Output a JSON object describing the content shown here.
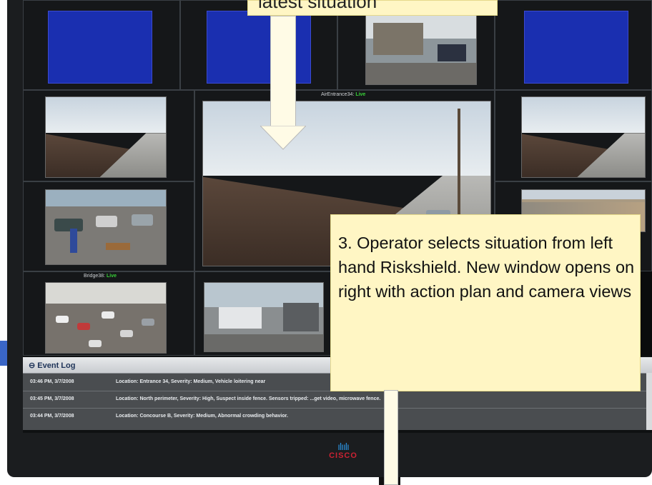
{
  "cameras": {
    "air_entrance": {
      "name": "AirEntrance34:",
      "status": "Live"
    },
    "bridge": {
      "name": "Bridge38:",
      "status": "Live"
    }
  },
  "event_log": {
    "title": "Event Log",
    "rows": [
      {
        "time": "03:46 PM, 3/7/2008",
        "message": "Location: Entrance 34, Severity: Medium, Vehicle loitering near"
      },
      {
        "time": "03:45 PM, 3/7/2008",
        "message": "Location: North perimeter, Severity: High, Suspect inside fence. Sensors tripped: ...get video, microwave fence."
      },
      {
        "time": "03:44 PM, 3/7/2008",
        "message": "Location: Concourse B, Severity: Medium, Abnormal crowding behavior."
      }
    ]
  },
  "logo": {
    "text": "CISCO"
  },
  "callouts": {
    "top": "latest situation",
    "right": "3. Operator selects situation from left hand Riskshield. New window opens on right  with action plan and camera views"
  },
  "colors": {
    "accent_blue": "#1a2fb0",
    "live_green": "#38d038",
    "callout_bg": "#fff6c4",
    "cisco_red": "#cc2233"
  }
}
